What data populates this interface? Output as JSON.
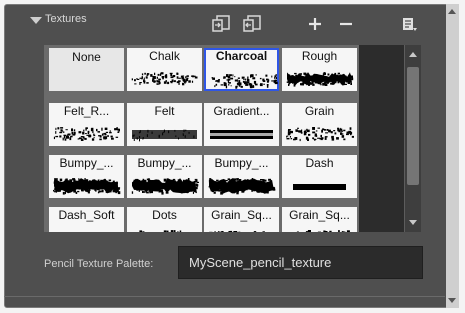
{
  "header": {
    "title": "Textures"
  },
  "toolbar_icons": [
    "import-texture-icon",
    "export-texture-icon",
    "add-icon",
    "remove-icon",
    "menu-icon"
  ],
  "textures": [
    {
      "label": "None",
      "swatch": "none"
    },
    {
      "label": "Chalk",
      "swatch": "chalk"
    },
    {
      "label": "Charcoal",
      "swatch": "charcoal",
      "selected": true
    },
    {
      "label": "Rough",
      "swatch": "rough"
    },
    {
      "label": "Felt_R...",
      "swatch": "felt_r"
    },
    {
      "label": "Felt",
      "swatch": "felt"
    },
    {
      "label": "Gradient...",
      "swatch": "gradient"
    },
    {
      "label": "Grain",
      "swatch": "grain"
    },
    {
      "label": "Bumpy_...",
      "swatch": "bumpy1"
    },
    {
      "label": "Bumpy_...",
      "swatch": "bumpy2"
    },
    {
      "label": "Bumpy_...",
      "swatch": "bumpy3"
    },
    {
      "label": "Dash",
      "swatch": "dash"
    },
    {
      "label": "Dash_Soft",
      "swatch": "dash_soft"
    },
    {
      "label": "Dots",
      "swatch": "dots"
    },
    {
      "label": "Grain_Sq...",
      "swatch": "grain_sq1"
    },
    {
      "label": "Grain_Sq...",
      "swatch": "grain_sq2"
    }
  ],
  "palette": {
    "label": "Pencil Texture Palette:",
    "value": "MyScene_pencil_texture"
  },
  "colors": {
    "selection": "#2f56e6",
    "panel": "#4f4f4f",
    "field": "#2b2b2b"
  }
}
